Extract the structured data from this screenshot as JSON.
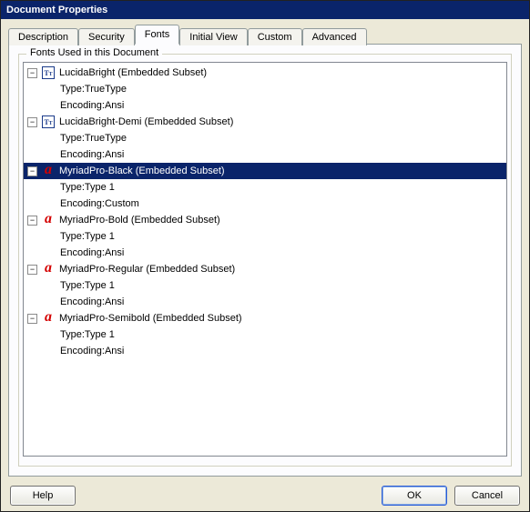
{
  "title": "Document Properties",
  "tabs": [
    "Description",
    "Security",
    "Fonts",
    "Initial View",
    "Custom",
    "Advanced"
  ],
  "active_tab": "Fonts",
  "legend": "Fonts Used in this Document",
  "buttons": {
    "help": "Help",
    "ok": "OK",
    "cancel": "Cancel"
  },
  "labels": {
    "type_prefix": "Type: ",
    "encoding_prefix": "Encoding: "
  },
  "fonts": [
    {
      "name": "LucidaBright (Embedded Subset)",
      "icon": "tt",
      "type": "TrueType",
      "encoding": "Ansi",
      "selected": false
    },
    {
      "name": "LucidaBright-Demi (Embedded Subset)",
      "icon": "tt",
      "type": "TrueType",
      "encoding": "Ansi",
      "selected": false
    },
    {
      "name": "MyriadPro-Black (Embedded Subset)",
      "icon": "a",
      "type": "Type 1",
      "encoding": "Custom",
      "selected": true
    },
    {
      "name": "MyriadPro-Bold (Embedded Subset)",
      "icon": "a",
      "type": "Type 1",
      "encoding": "Ansi",
      "selected": false
    },
    {
      "name": "MyriadPro-Regular (Embedded Subset)",
      "icon": "a",
      "type": "Type 1",
      "encoding": "Ansi",
      "selected": false
    },
    {
      "name": "MyriadPro-Semibold (Embedded Subset)",
      "icon": "a",
      "type": "Type 1",
      "encoding": "Ansi",
      "selected": false
    }
  ]
}
